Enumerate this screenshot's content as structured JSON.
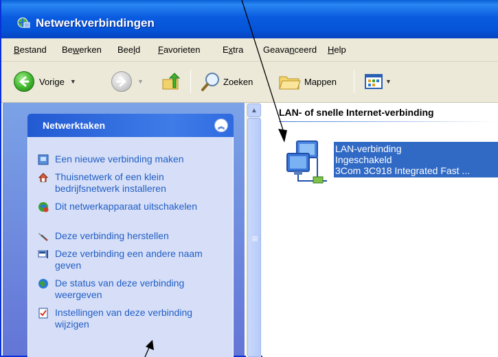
{
  "window": {
    "title": "Netwerkverbindingen"
  },
  "menu": [
    {
      "label": "Bestand",
      "mnemonic_index": 0
    },
    {
      "label": "Bewerken",
      "mnemonic_index": 2
    },
    {
      "label": "Beeld",
      "mnemonic_index": 3
    },
    {
      "label": "Favorieten",
      "mnemonic_index": 0
    },
    {
      "label": "Extra",
      "mnemonic_index": 1
    },
    {
      "label": "Geavanceerd",
      "mnemonic_index": 5
    },
    {
      "label": "Help",
      "mnemonic_index": 0
    }
  ],
  "toolbar": {
    "back_label": "Vorige",
    "search_label": "Zoeken",
    "folders_label": "Mappen"
  },
  "taskpane": {
    "title": "Netwerktaken",
    "tasks": [
      {
        "label": "Een nieuwe verbinding maken",
        "icon": "new-connection-icon"
      },
      {
        "label": "Thuisnetwerk of een klein bedrijfsnetwerk installeren",
        "icon": "home-network-icon"
      },
      {
        "label": "Dit netwerkapparaat uitschakelen",
        "icon": "disable-device-icon"
      },
      {
        "label": "Deze verbinding herstellen",
        "icon": "repair-icon"
      },
      {
        "label": "Deze verbinding een andere naam geven",
        "icon": "rename-icon"
      },
      {
        "label": "De status van deze verbinding weergeven",
        "icon": "status-icon"
      },
      {
        "label": "Instellingen van deze verbinding wijzigen",
        "icon": "settings-icon"
      }
    ]
  },
  "content": {
    "group_header": "LAN- of snelle Internet-verbinding",
    "connection": {
      "name": "LAN-verbinding",
      "status": "Ingeschakeld",
      "device": "3Com 3C918 Integrated Fast ..."
    }
  },
  "colors": {
    "title_bar": "#0553d6",
    "task_link": "#215dc6",
    "selection": "#316ac5",
    "chrome": "#ece9d8"
  }
}
